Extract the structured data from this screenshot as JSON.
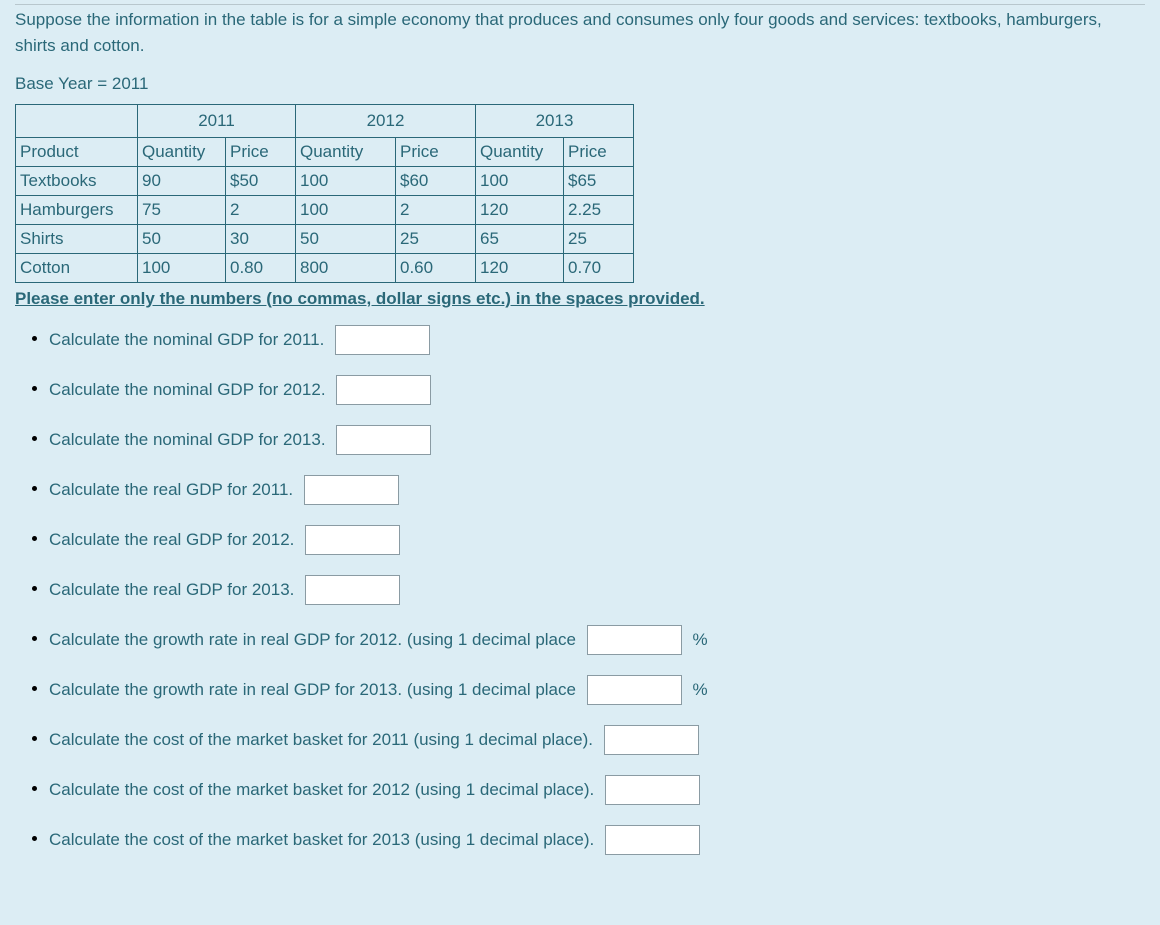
{
  "intro": "Suppose the information in the table is for a simple economy that produces and consumes only four goods and services: textbooks, hamburgers, shirts and cotton.",
  "baseYear": "Base Year = 2011",
  "table": {
    "years": [
      "2011",
      "2012",
      "2013"
    ],
    "colHeaders": {
      "product": "Product",
      "quantity": "Quantity",
      "price": "Price"
    },
    "rows": [
      {
        "product": "Textbooks",
        "q1": "90",
        "p1": "$50",
        "q2": "100",
        "p2": "$60",
        "q3": "100",
        "p3": "$65"
      },
      {
        "product": "Hamburgers",
        "q1": "75",
        "p1": "2",
        "q2": "100",
        "p2": "2",
        "q3": "120",
        "p3": "2.25"
      },
      {
        "product": "Shirts",
        "q1": "50",
        "p1": "30",
        "q2": "50",
        "p2": "25",
        "q3": "65",
        "p3": "25"
      },
      {
        "product": "Cotton",
        "q1": "100",
        "p1": "0.80",
        "q2": "800",
        "p2": "0.60",
        "q3": "120",
        "p3": "0.70"
      }
    ]
  },
  "instruction": " Please enter only the numbers (no commas, dollar signs etc.) in the spaces provided.",
  "questions": [
    {
      "text": "Calculate the nominal GDP for 2011.",
      "suffix": ""
    },
    {
      "text": "Calculate the nominal GDP for 2012.",
      "suffix": ""
    },
    {
      "text": "Calculate the nominal GDP for 2013.",
      "suffix": ""
    },
    {
      "text": "Calculate the real GDP for 2011.",
      "suffix": ""
    },
    {
      "text": "Calculate the real GDP for 2012.",
      "suffix": ""
    },
    {
      "text": "Calculate the real GDP for 2013.",
      "suffix": ""
    },
    {
      "text": "Calculate the growth rate in real GDP for 2012. (using 1 decimal place",
      "suffix": "%"
    },
    {
      "text": "Calculate the growth rate in real GDP for 2013. (using 1 decimal place",
      "suffix": "%"
    },
    {
      "text": "Calculate the cost of the market basket for 2011 (using 1 decimal place).",
      "suffix": ""
    },
    {
      "text": "Calculate the cost of the market basket for 2012 (using 1 decimal place).",
      "suffix": ""
    },
    {
      "text": "Calculate the cost of the market basket for 2013 (using 1 decimal place).",
      "suffix": ""
    }
  ]
}
